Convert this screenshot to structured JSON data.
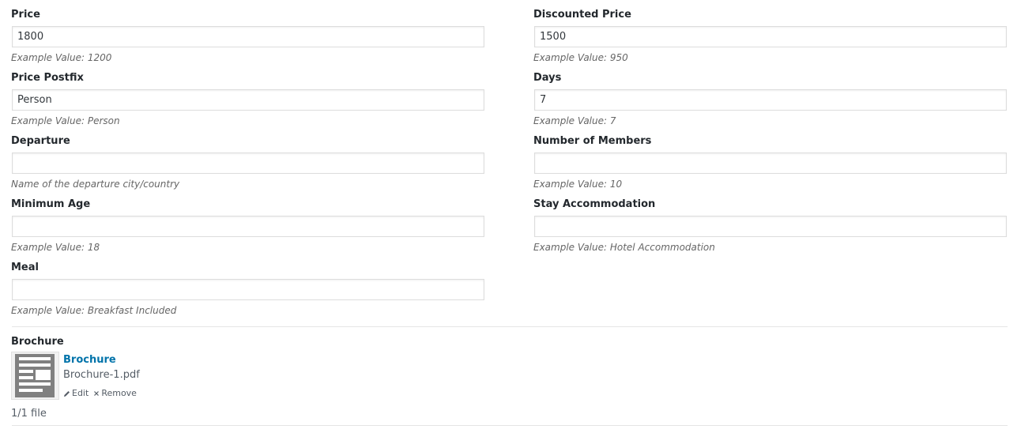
{
  "fields": {
    "price": {
      "label": "Price",
      "value": "1800",
      "description": "Example Value: 1200"
    },
    "discounted_price": {
      "label": "Discounted Price",
      "value": "1500",
      "description": "Example Value: 950"
    },
    "price_postfix": {
      "label": "Price Postfix",
      "value": "Person",
      "description": "Example Value: Person"
    },
    "days": {
      "label": "Days",
      "value": "7",
      "description": "Example Value: 7"
    },
    "departure": {
      "label": "Departure",
      "value": "",
      "description": "Name of the departure city/country"
    },
    "number_of_members": {
      "label": "Number of Members",
      "value": "",
      "description": "Example Value: 10"
    },
    "minimum_age": {
      "label": "Minimum Age",
      "value": "",
      "description": "Example Value: 18"
    },
    "stay_accommodation": {
      "label": "Stay Accommodation",
      "value": "",
      "description": "Example Value: Hotel Accommodation"
    },
    "meal": {
      "label": "Meal",
      "value": "",
      "description": "Example Value: Breakfast Included"
    }
  },
  "brochure": {
    "label": "Brochure",
    "file_title": "Brochure",
    "file_name": "Brochure-1.pdf",
    "edit_label": "Edit",
    "remove_label": "Remove",
    "file_count": "1/1 file",
    "thumbnail_icon": "document-icon"
  },
  "colors": {
    "link": "#0073aa",
    "description": "#666666",
    "border": "#dddddd"
  }
}
